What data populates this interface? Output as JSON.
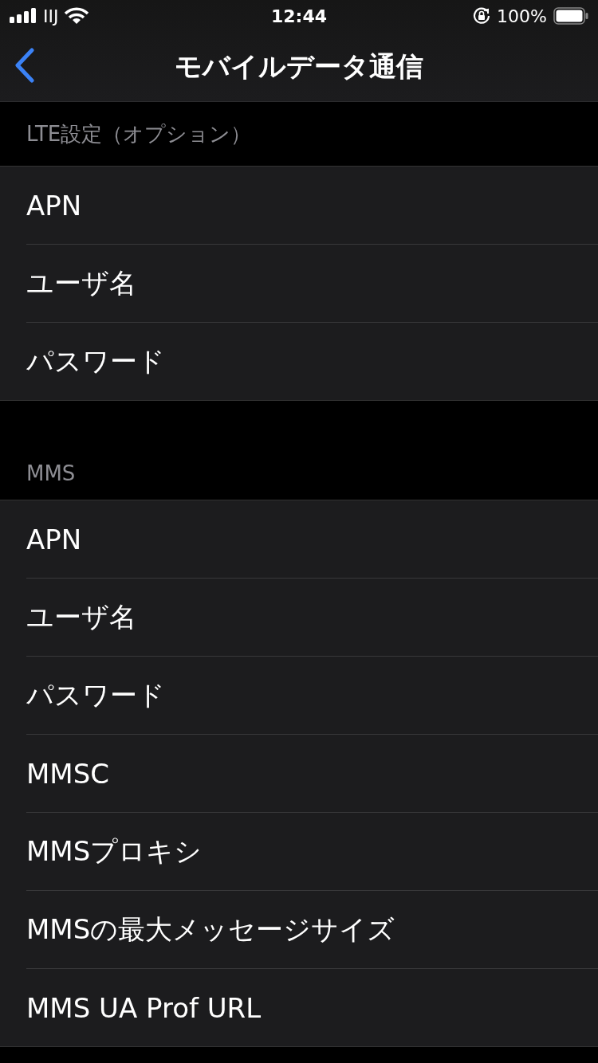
{
  "status_bar": {
    "carrier": "IIJ",
    "time": "12:44",
    "battery": "100%"
  },
  "nav": {
    "title": "モバイルデータ通信"
  },
  "sections": [
    {
      "header": "LTE設定（オプション）",
      "rows": [
        "APN",
        "ユーザ名",
        "パスワード"
      ]
    },
    {
      "header": "MMS",
      "rows": [
        "APN",
        "ユーザ名",
        "パスワード",
        "MMSC",
        "MMSプロキシ",
        "MMSの最大メッセージサイズ",
        "MMS UA Prof URL"
      ]
    }
  ]
}
